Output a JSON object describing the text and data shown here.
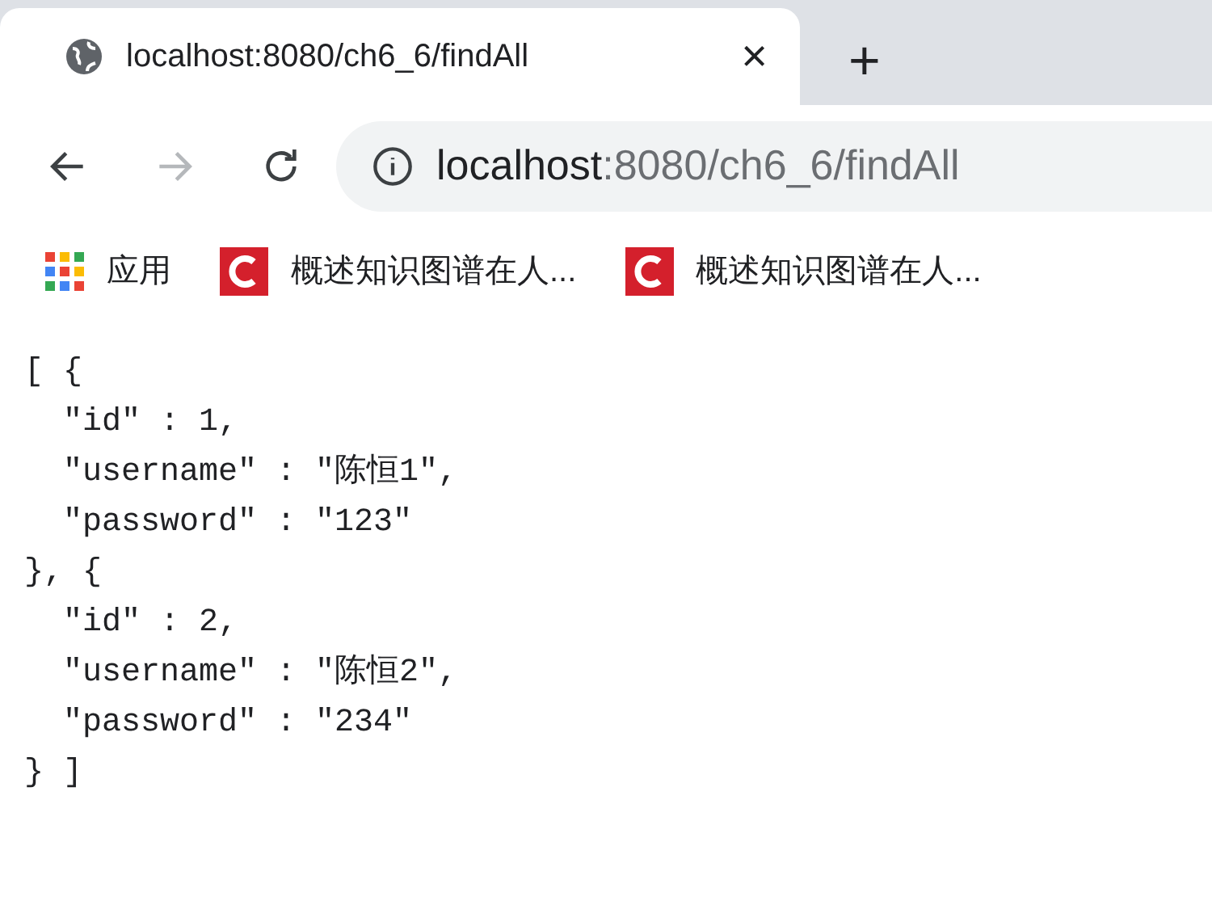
{
  "tab": {
    "title": "localhost:8080/ch6_6/findAll",
    "close": "×",
    "new_tab": "+"
  },
  "address_bar": {
    "host": "localhost",
    "rest": ":8080/ch6_6/findAll"
  },
  "bookmarks": [
    {
      "kind": "apps",
      "label": "应用"
    },
    {
      "kind": "site",
      "label": "概述知识图谱在人..."
    },
    {
      "kind": "site",
      "label": "概述知识图谱在人..."
    }
  ],
  "content_lines": [
    "[ {",
    "  \"id\" : 1,",
    "  \"username\" : \"陈恒1\",",
    "  \"password\" : \"123\"",
    "}, {",
    "  \"id\" : 2,",
    "  \"username\" : \"陈恒2\",",
    "  \"password\" : \"234\"",
    "} ]"
  ]
}
